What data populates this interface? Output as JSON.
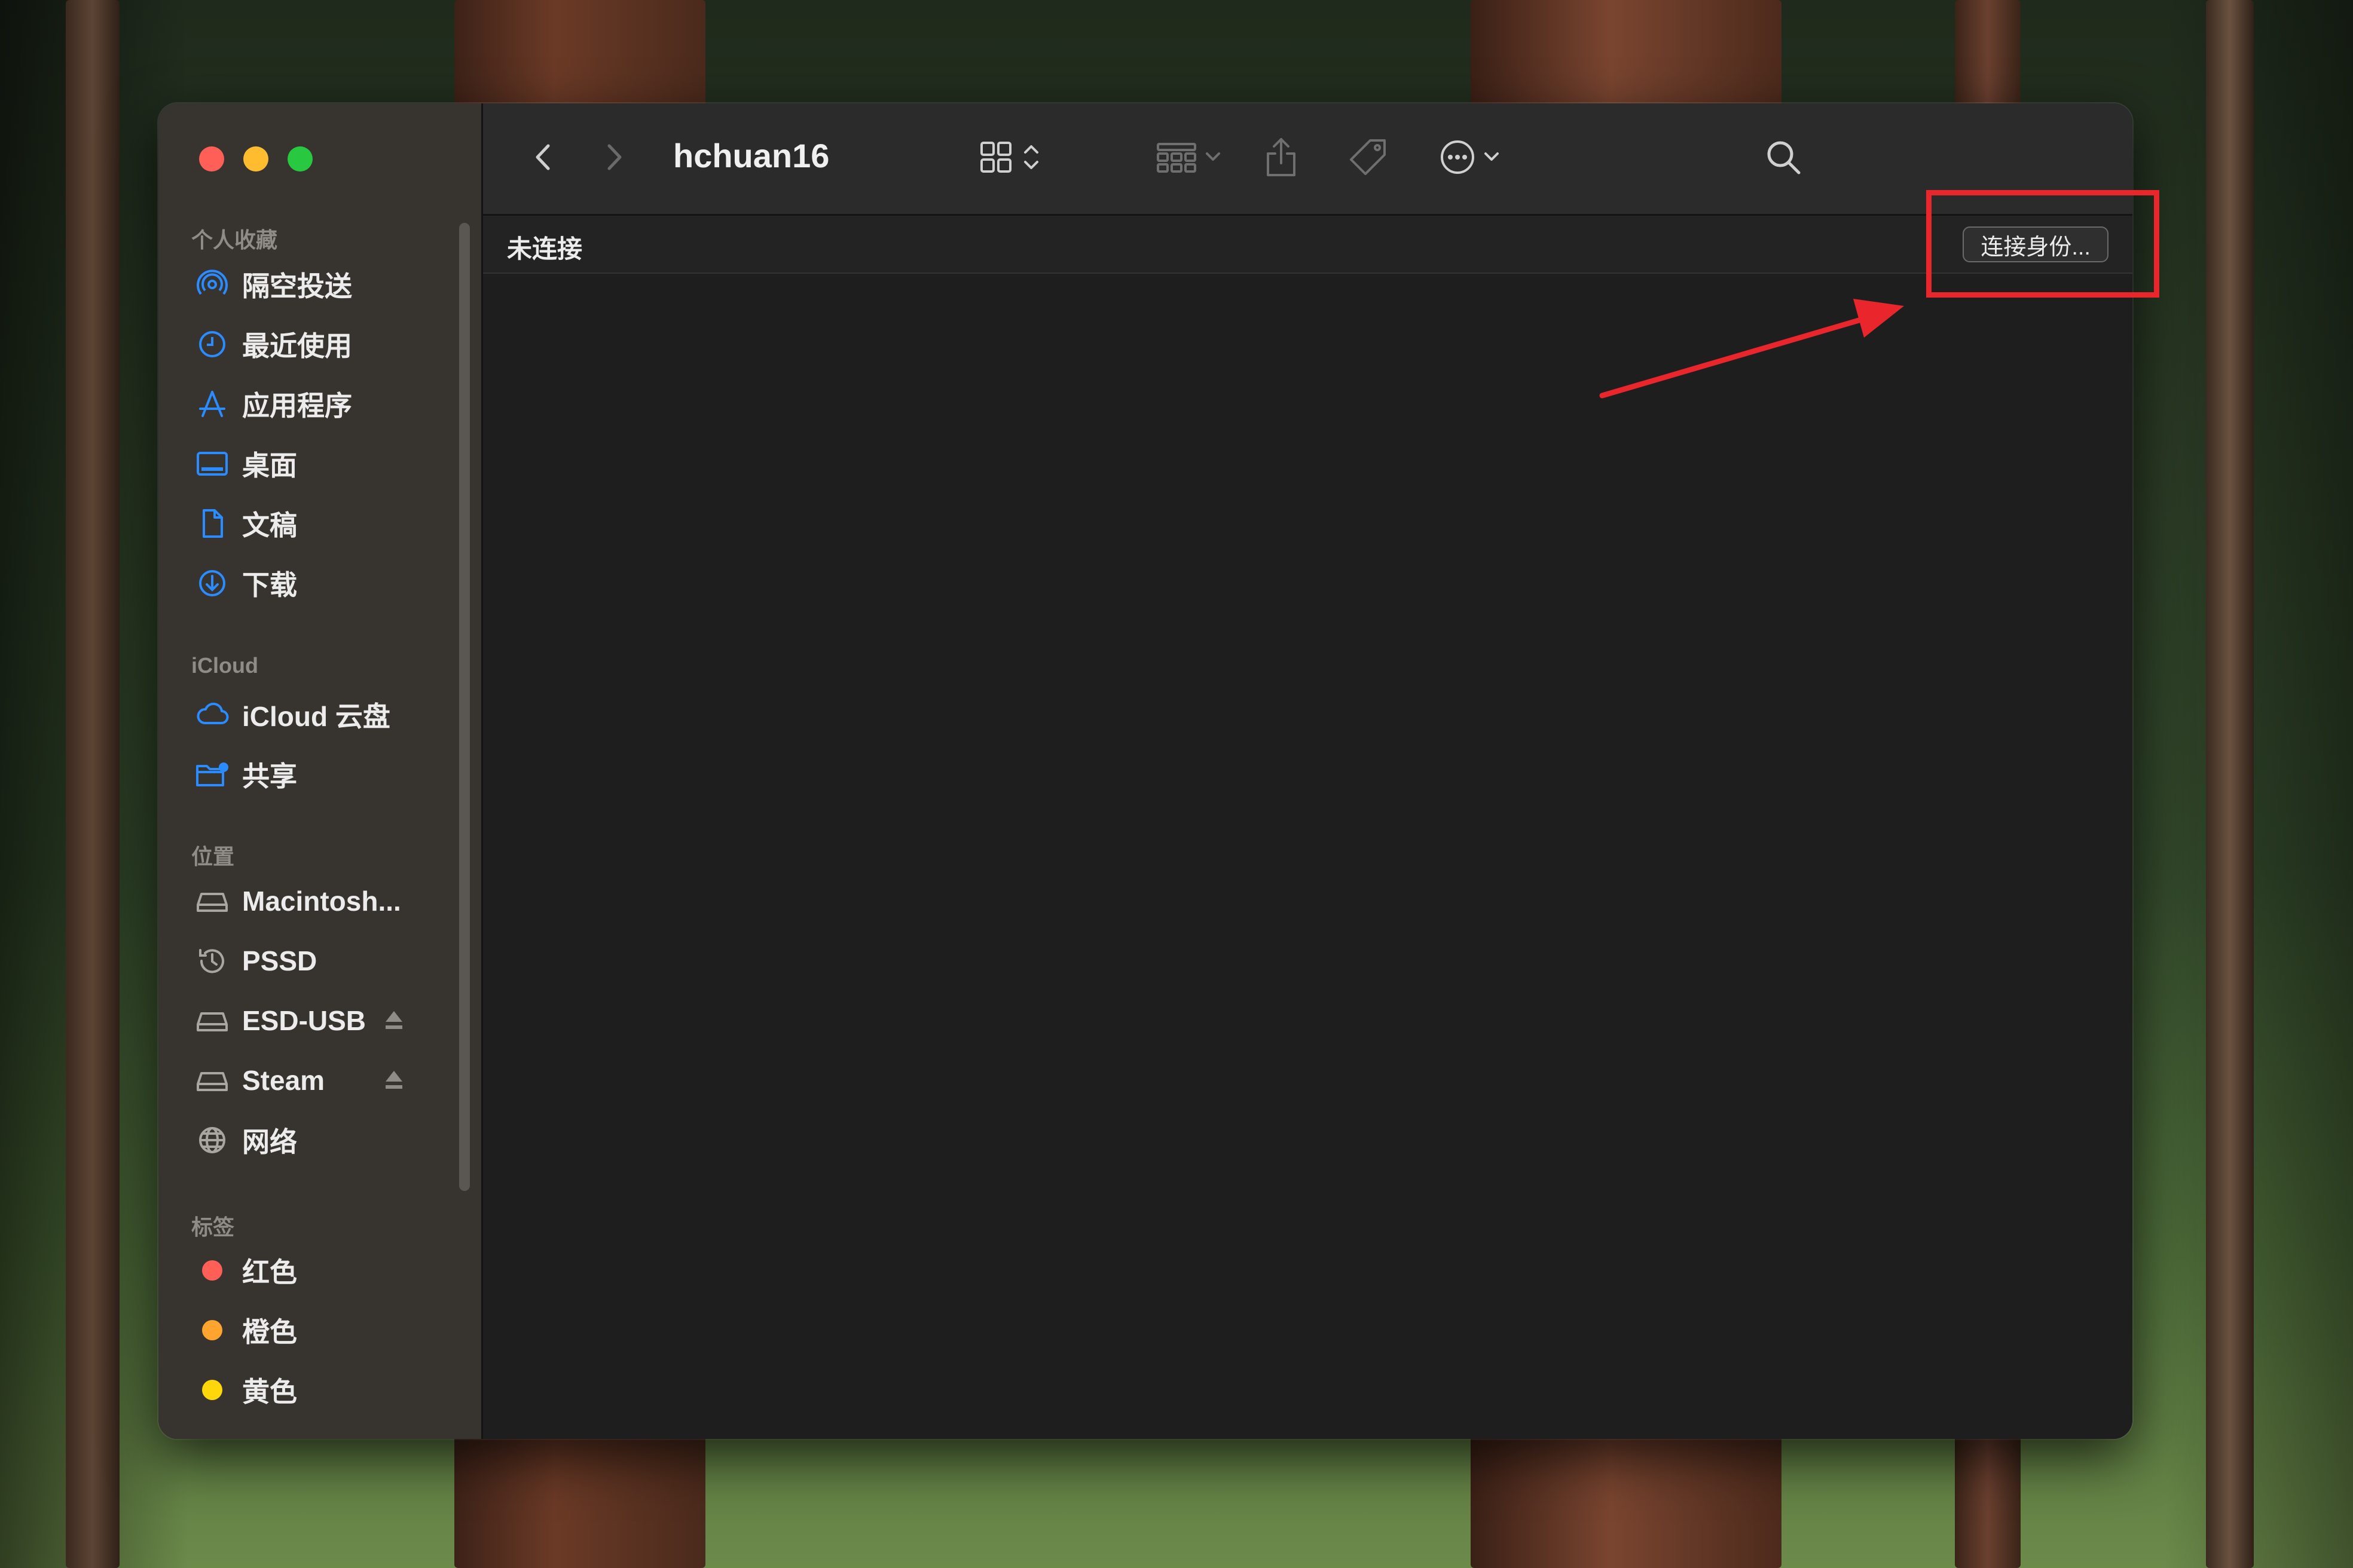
{
  "window": {
    "title": "hchuan16"
  },
  "sidebar": {
    "sections": [
      {
        "title": "个人收藏",
        "items": [
          {
            "label": "隔空投送",
            "icon": "airdrop-icon"
          },
          {
            "label": "最近使用",
            "icon": "clock-icon"
          },
          {
            "label": "应用程序",
            "icon": "applications-icon"
          },
          {
            "label": "桌面",
            "icon": "desktop-icon"
          },
          {
            "label": "文稿",
            "icon": "document-icon"
          },
          {
            "label": "下载",
            "icon": "download-icon"
          }
        ]
      },
      {
        "title": "iCloud",
        "items": [
          {
            "label": "iCloud 云盘",
            "icon": "icloud-icon"
          },
          {
            "label": "共享",
            "icon": "shared-folder-icon"
          }
        ]
      },
      {
        "title": "位置",
        "items": [
          {
            "label": "Macintosh...",
            "icon": "drive-icon"
          },
          {
            "label": "PSSD",
            "icon": "time-machine-icon"
          },
          {
            "label": "ESD-USB",
            "icon": "drive-icon",
            "eject": true
          },
          {
            "label": "Steam",
            "icon": "drive-icon",
            "eject": true
          },
          {
            "label": "网络",
            "icon": "globe-icon"
          }
        ]
      },
      {
        "title": "标签",
        "items": [
          {
            "label": "红色",
            "color": "#ff5f57"
          },
          {
            "label": "橙色",
            "color": "#ffa42e"
          },
          {
            "label": "黄色",
            "color": "#ffd60a"
          }
        ]
      }
    ]
  },
  "pathbar": {
    "status": "未连接",
    "connect_label": "连接身份..."
  },
  "colors": {
    "accent": "#2a8cff",
    "close": "#ff5f57",
    "minimize": "#febc2e",
    "zoom": "#28c840",
    "annotation": "#e8262b"
  }
}
